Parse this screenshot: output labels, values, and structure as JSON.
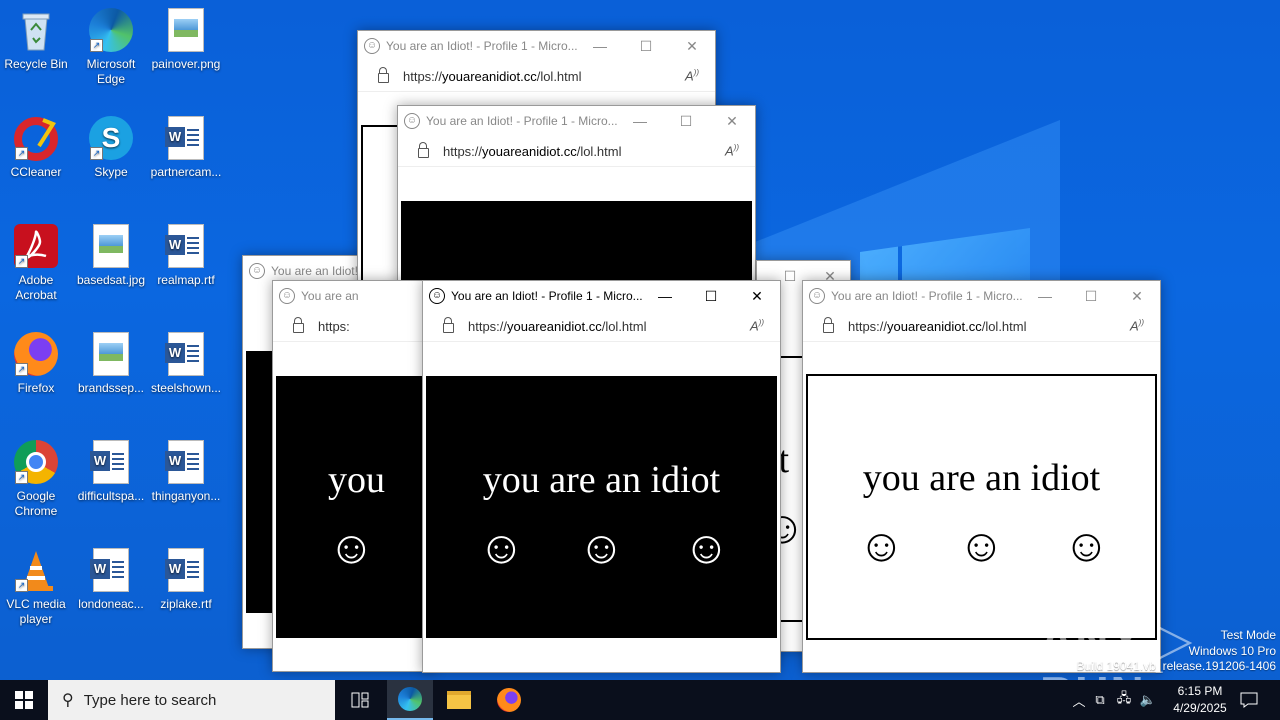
{
  "desktop": {
    "icons": [
      {
        "label": "Recycle Bin"
      },
      {
        "label": "Microsoft Edge"
      },
      {
        "label": "painover.png"
      },
      {
        "label": "CCleaner"
      },
      {
        "label": "Skype"
      },
      {
        "label": "partnercam..."
      },
      {
        "label": "Adobe Acrobat"
      },
      {
        "label": "basedsat.jpg"
      },
      {
        "label": "realmap.rtf"
      },
      {
        "label": "Firefox"
      },
      {
        "label": "brandssep..."
      },
      {
        "label": "steelshown..."
      },
      {
        "label": "Google Chrome"
      },
      {
        "label": "difficultspa..."
      },
      {
        "label": "thinganyon..."
      },
      {
        "label": "VLC media player"
      },
      {
        "label": "londoneac..."
      },
      {
        "label": "ziplake.rtf"
      }
    ]
  },
  "browser": {
    "title_full": "You are an Idiot! - Profile 1 - Micro...",
    "title_short": "You are an Idiot!",
    "title_shorter": "You are an",
    "url_prefix": "https://",
    "url_domain": "youareanidiot.cc",
    "url_path": "/lol.html",
    "url_cut": "https:",
    "message": "you are an idiot",
    "message_cut": "you",
    "message_cut_right": "ot",
    "minimize": "—",
    "maximize": "☐",
    "close": "✕",
    "read_aloud": "A͉"
  },
  "taskbar": {
    "search_placeholder": "Type here to search",
    "time": "6:15 PM",
    "date": "4/29/2025"
  },
  "overlay": {
    "watermark": "ANY ▷ RUN",
    "test_mode": "Test Mode",
    "os": "Windows 10 Pro",
    "build": "Build 19041.vb_release.191206-1406"
  }
}
